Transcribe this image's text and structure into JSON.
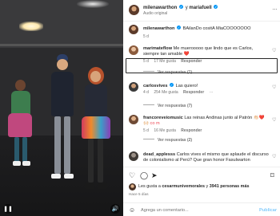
{
  "header": {
    "user1": "milenawarthon",
    "conj": "y",
    "user2": "mariafuell",
    "audio": "Audio original",
    "more": "…"
  },
  "caption": {
    "user": "milenawarthon",
    "text": "BAilanDo cositA MiaCOOOOOOO",
    "time": "5 d"
  },
  "comments": [
    {
      "user": "marimateflow",
      "text": "Me muerooooo que lindo que es Carlos, siempre tan amable",
      "emoji": "❤️",
      "time": "5 d",
      "likes": "17 Me gusta",
      "reply": "Responder",
      "replies": "Ver respuestas (1)"
    },
    {
      "user": "carlosvives",
      "text": "Las quiero!",
      "time": "4 d",
      "likes": "254 Me gusta",
      "reply": "Responder",
      "more": "···",
      "replies": "Ver respuestas (7)"
    },
    {
      "user": "francoreveiomusic",
      "text": "Las reinas Andinas junto al Patrón",
      "emoji": "👏🏻❤️🙌🏻 co m",
      "time": "5 d",
      "likes": "16 Me gusta",
      "reply": "Responder",
      "replies": "Ver respuestas (2)"
    },
    {
      "user": "dead_applesss",
      "text": "Carlos vives el mismo que aplaude el discurso de colonialismo al Perú? Que gran honor Fasulwarton",
      "time": "",
      "likes": "",
      "reply": ""
    }
  ],
  "likes_line": {
    "prefix": "Les gusta a",
    "user": "cesarmunivemorales",
    "middle": "y",
    "count": "3941 personas más"
  },
  "date": "Hace 5 días",
  "add_comment": {
    "placeholder": "Agrega un comentario...",
    "publish": "Publicar"
  },
  "icons": {
    "like": "heart-icon",
    "comment": "comment-icon",
    "share": "share-icon",
    "save": "bookmark-icon"
  },
  "colors": {
    "accent": "#0095f6",
    "heart_red": "#ed4956",
    "text": "#262626",
    "muted": "#737373"
  }
}
